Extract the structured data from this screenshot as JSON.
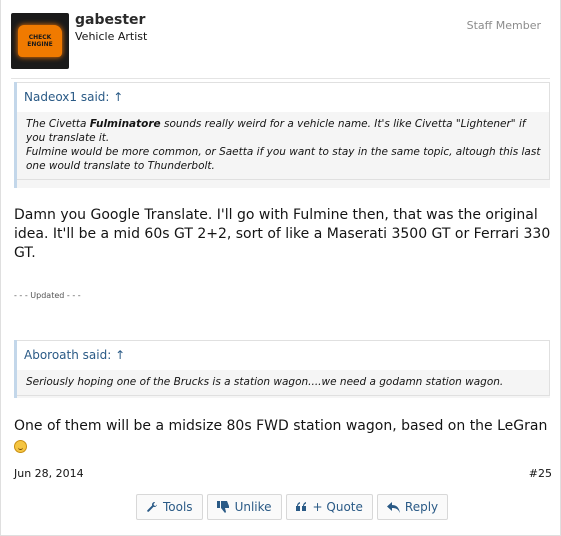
{
  "post": {
    "author": "gabester",
    "user_title": "Vehicle Artist",
    "banner": "Staff Member",
    "avatar_text": "CHECK ENGINE",
    "date": "Jun 28, 2014",
    "number": "#25"
  },
  "quote1": {
    "header": "Nadeox1 said:",
    "arrow": "↑",
    "line1_pre": "The Civetta ",
    "line1_bold": "Fulminatore",
    "line1_post": " sounds really weird for a vehicle name. It's like Civetta \"Lightener\" if you translate it.",
    "line2": "Fulmine would be more common, or Saetta if you want to stay in the same topic, altough this last one would translate to Thunderbolt."
  },
  "reply1": "Damn you Google Translate. I'll go with Fulmine then, that was the original idea. It'll be a mid 60s GT 2+2, sort of like a Maserati 3500 GT or Ferrari 330 GT.",
  "updated_label": "- - - Updated - - -",
  "quote2": {
    "header": "Aboroath said:",
    "arrow": "↑",
    "body": "Seriously hoping one of the Brucks is a station wagon....we need a godamn station wagon."
  },
  "reply2": "One of them will be a midsize 80s FWD station wagon, based on the LeGran",
  "actions": {
    "tools": "Tools",
    "unlike": "Unlike",
    "quote": "+ Quote",
    "reply": "Reply"
  },
  "icons": {
    "tools": "wrench-icon",
    "unlike": "thumbs-down-icon",
    "quote": "quote-marks-icon",
    "reply": "reply-arrow-icon"
  },
  "colors": {
    "link": "#2a5a86",
    "quote_bar": "#c3d7ea",
    "quote_bg": "#f5f5f5"
  }
}
